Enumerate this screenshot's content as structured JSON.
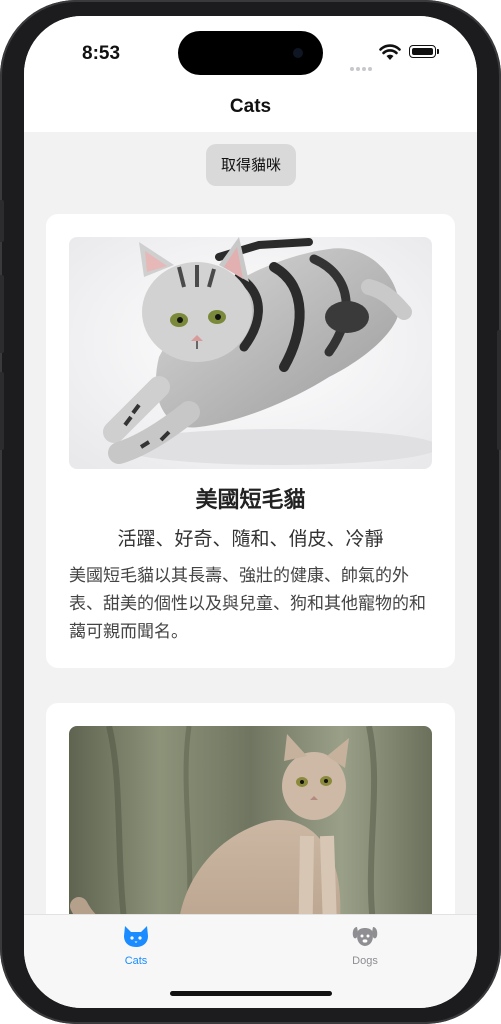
{
  "status": {
    "time": "8:53"
  },
  "nav": {
    "title": "Cats"
  },
  "actions": {
    "fetch_label": "取得貓咪"
  },
  "cards": [
    {
      "name": "美國短毛貓",
      "traits": "活躍、好奇、隨和、俏皮、冷靜",
      "description": "美國短毛貓以其長壽、強壯的健康、帥氣的外表、甜美的個性以及與兒童、狗和其他寵物的和藹可親而聞名。",
      "photo": "silver-tabby-cat-photo"
    },
    {
      "photo": "sitting-tabby-cat-photo"
    }
  ],
  "tabs": [
    {
      "label": "Cats",
      "icon": "cat-icon",
      "selected": true
    },
    {
      "label": "Dogs",
      "icon": "dog-icon",
      "selected": false
    }
  ],
  "colors": {
    "accent": "#1a8cff",
    "inactive": "#8e8e93",
    "background": "#f2f2f2"
  }
}
